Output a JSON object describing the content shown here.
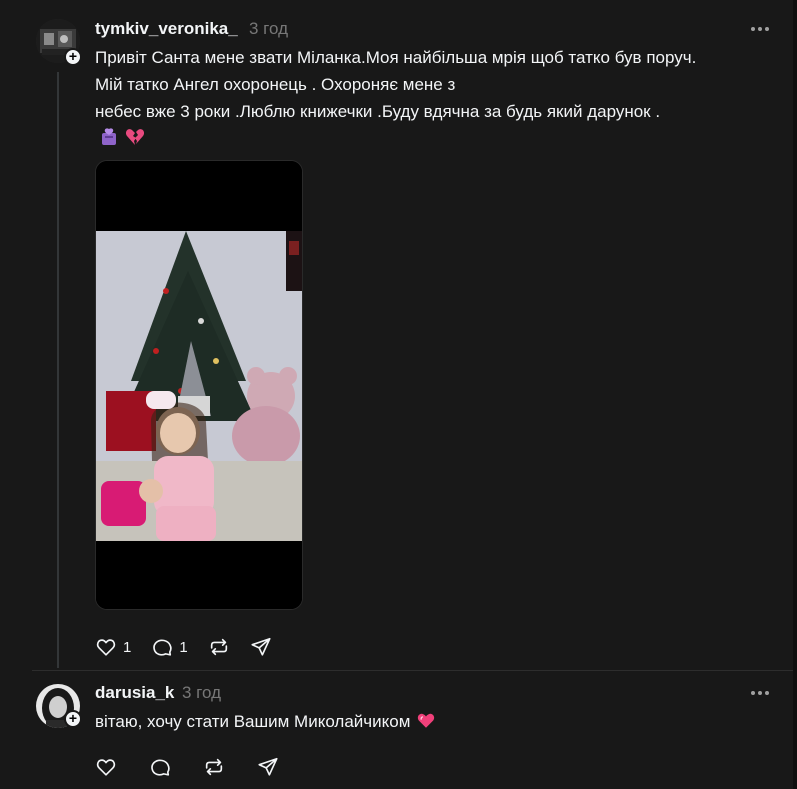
{
  "posts": [
    {
      "username": "tymkiv_veronika_",
      "timestamp": "3 год",
      "text_lines": [
        "Привіт Санта мене звати Міланка.Моя найбільша мрія щоб татко був поруч.",
        "Мій татко Ангел охоронець . Охороняє мене з",
        "небес вже 3 роки .Люблю книжечки .Буду вдячна за будь який дарунок ."
      ],
      "emojis": [
        "purple-heart-decoration-icon",
        "broken-heart-icon"
      ],
      "likes": "1",
      "comments": "1"
    },
    {
      "username": "darusia_k",
      "timestamp": "3 год",
      "text": "вітаю, хочу стати Вашим Миколайчиком",
      "emojis": [
        "pink-heart-icon"
      ]
    }
  ]
}
